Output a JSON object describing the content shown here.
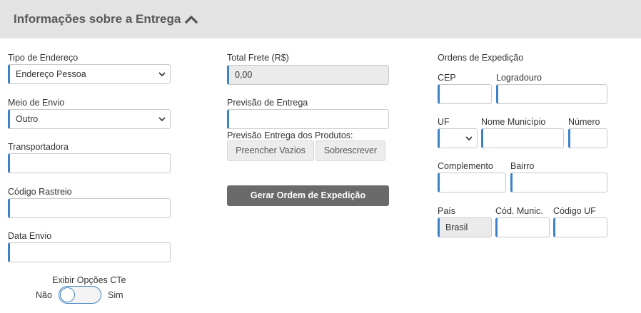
{
  "header": {
    "title": "Informações sobre a Entrega",
    "toggle_icon": "chevron-up-icon"
  },
  "left": {
    "tipo_endereco": {
      "label": "Tipo de Endereço",
      "value": "Endereço Pessoa"
    },
    "meio_envio": {
      "label": "Meio de Envio",
      "value": "Outro"
    },
    "transportadora": {
      "label": "Transportadora",
      "value": ""
    },
    "codigo_rastreio": {
      "label": "Código Rastreio",
      "value": ""
    },
    "data_envio": {
      "label": "Data Envio",
      "value": ""
    },
    "cte": {
      "label": "Exibir Opções CTe",
      "off_label": "Não",
      "on_label": "Sim",
      "checked": false
    }
  },
  "middle": {
    "total_frete": {
      "label": "Total Frete (R$)",
      "value": "0,00"
    },
    "previsao_entrega": {
      "label": "Previsão de Entrega",
      "value": ""
    },
    "previsao_produtos": {
      "label": "Previsão Entrega dos Produtos:"
    },
    "preencher_vazios": "Preencher Vazios",
    "sobrescrever": "Sobrescrever",
    "gerar_ordem": "Gerar Ordem de Expedição"
  },
  "right": {
    "title": "Ordens de Expedição",
    "cep": {
      "label": "CEP",
      "value": ""
    },
    "logradouro": {
      "label": "Logradouro",
      "value": ""
    },
    "uf": {
      "label": "UF",
      "value": ""
    },
    "municipio": {
      "label": "Nome Município",
      "value": ""
    },
    "numero": {
      "label": "Número",
      "value": ""
    },
    "complemento": {
      "label": "Complemento",
      "value": ""
    },
    "bairro": {
      "label": "Bairro",
      "value": ""
    },
    "pais": {
      "label": "País",
      "value": "Brasil"
    },
    "cod_munic": {
      "label": "Cód. Munic.",
      "value": ""
    },
    "codigo_uf": {
      "label": "Código UF",
      "value": ""
    }
  },
  "colors": {
    "accent": "#3c82c4",
    "header_bg": "#e3e3e3",
    "button_dark": "#6a6a6a"
  }
}
